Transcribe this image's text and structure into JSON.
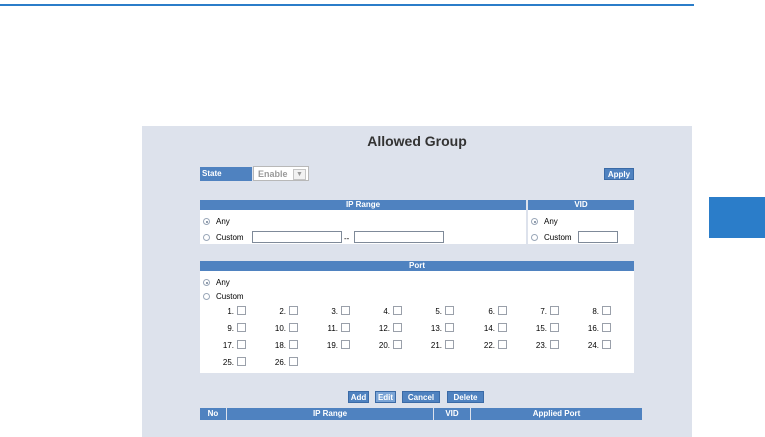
{
  "title": "Allowed Group",
  "state": {
    "label": "State",
    "value": "Enable"
  },
  "apply_label": "Apply",
  "ip_range": {
    "header": "IP Range",
    "any_label": "Any",
    "custom_label": "Custom",
    "separator": "--",
    "start_value": "",
    "end_value": "",
    "selected": "Any"
  },
  "vid": {
    "header": "VID",
    "any_label": "Any",
    "custom_label": "Custom",
    "value": "",
    "selected": "Any"
  },
  "port": {
    "header": "Port",
    "any_label": "Any",
    "custom_label": "Custom",
    "selected": "Any",
    "ports": [
      "1.",
      "2.",
      "3.",
      "4.",
      "5.",
      "6.",
      "7.",
      "8.",
      "9.",
      "10.",
      "11.",
      "12.",
      "13.",
      "14.",
      "15.",
      "16.",
      "17.",
      "18.",
      "19.",
      "20.",
      "21.",
      "22.",
      "23.",
      "24.",
      "25.",
      "26."
    ]
  },
  "actions": {
    "add": "Add",
    "edit": "Edit",
    "cancel": "Cancel",
    "delete": "Delete"
  },
  "table": {
    "columns": [
      "No",
      "IP Range",
      "VID",
      "Applied Port"
    ]
  },
  "colors": {
    "accent": "#2b7dc9",
    "header_bg": "#4f82c0",
    "panel_bg": "#dde2ec"
  }
}
